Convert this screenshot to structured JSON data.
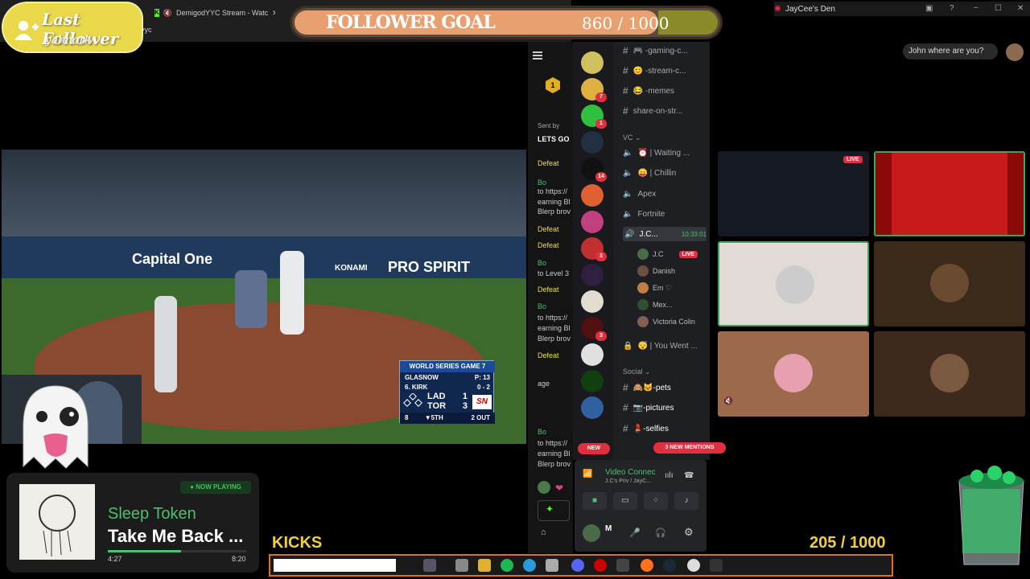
{
  "browser": {
    "tab1": "DemigodYYC Stream - Watc",
    "url": "dyyc"
  },
  "follower": {
    "title": "Last Follower",
    "name": "yalmark"
  },
  "goal": {
    "title": "FOLLOWER GOAL",
    "count": "860  /  1000",
    "current": 860,
    "target": 1000
  },
  "video": {
    "ads": [
      "Capital One",
      "KONAMI",
      "PRO SPIRIT"
    ],
    "scorebug": {
      "header": "WORLD SERIES GAME 7",
      "pitcher": "GLASNOW",
      "pitch_count": "P: 13",
      "batter": "6. KIRK",
      "count": "0 - 2",
      "team1": "LAD",
      "score1": "1",
      "team2": "TOR",
      "score2": "3",
      "number": "8",
      "inning": "▼5TH",
      "outs": "2 OUT",
      "network": "SN"
    }
  },
  "now_playing": {
    "badge": "● NOW PLAYING",
    "artist": "Sleep Token",
    "song": "Take Me Back ...",
    "elapsed": "4:27",
    "duration": "8:20",
    "progress": 0.53
  },
  "overlay": {
    "kicks_label": "KICKS",
    "kicks_count": "205  / 1000"
  },
  "chat": {
    "top_badge": "1",
    "pinned_label": "Sent by",
    "pinned_text": "LETS GO",
    "lines": [
      {
        "text": "Defeat",
        "color": "#e8e040"
      },
      {
        "text": "Bo",
        "color": "#4ec070"
      },
      {
        "text": "to https://",
        "color": "#ccc"
      },
      {
        "text": "earning Bl",
        "color": "#ccc"
      },
      {
        "text": "Blerp brov",
        "color": "#ccc"
      },
      {
        "text": "Defeat",
        "color": "#e8e040"
      },
      {
        "text": "Defeat",
        "color": "#e8e040"
      },
      {
        "text": "Bo",
        "color": "#4ec070"
      },
      {
        "text": "to Level 3",
        "color": "#ccc"
      },
      {
        "text": "Defeat",
        "color": "#e8e040"
      },
      {
        "text": "Bo",
        "color": "#4ec070"
      },
      {
        "text": "to https://",
        "color": "#ccc"
      },
      {
        "text": "earning Bl",
        "color": "#ccc"
      },
      {
        "text": "Blerp brov",
        "color": "#ccc"
      },
      {
        "text": "Defeat",
        "color": "#e8e040"
      },
      {
        "text": "",
        "color": "#ccc"
      },
      {
        "text": "age",
        "color": "#ccc"
      },
      {
        "text": "",
        "color": "#ccc"
      },
      {
        "text": "",
        "color": "#ccc"
      },
      {
        "text": "Bo",
        "color": "#4ec070"
      },
      {
        "text": "to https://",
        "color": "#ccc"
      },
      {
        "text": "earning Bl",
        "color": "#ccc"
      },
      {
        "text": "Blerp brov",
        "color": "#ccc"
      }
    ]
  },
  "servers": {
    "new_label": "NEW",
    "icons": [
      {
        "color": "#d0c060",
        "badge": ""
      },
      {
        "color": "#e0b040",
        "badge": "7"
      },
      {
        "color": "#30c040",
        "badge": "1"
      },
      {
        "color": "#203040",
        "badge": ""
      },
      {
        "color": "#111111",
        "badge": "14"
      },
      {
        "color": "#e06030",
        "badge": ""
      },
      {
        "color": "#c04080",
        "badge": ""
      },
      {
        "color": "#c03030",
        "badge": "3"
      },
      {
        "color": "#302040",
        "badge": ""
      },
      {
        "color": "#e0dcd0",
        "badge": ""
      },
      {
        "color": "#501010",
        "badge": "3"
      },
      {
        "color": "#e0e0e0",
        "badge": ""
      },
      {
        "color": "#104010",
        "badge": ""
      },
      {
        "color": "#3060a0",
        "badge": ""
      }
    ]
  },
  "channels": {
    "text1": [
      "🎮 -gaming-c...",
      "😊 -stream-c...",
      "😂 -memes",
      "share-on-str..."
    ],
    "vc_label": "VC ⌄",
    "voice": [
      "⏰ | Waiting ...",
      "😛 | Chillin",
      "Apex",
      "Fortnite"
    ],
    "active_vc": "J.C...",
    "active_vc_time": "10:33:01",
    "vc_users": [
      {
        "name": "J.C",
        "live": "LIVE",
        "color": "#4a6a4a"
      },
      {
        "name": "Danish",
        "live": "",
        "color": "#6a5040"
      },
      {
        "name": "Em ♡",
        "live": "",
        "color": "#c08040"
      },
      {
        "name": "Mex...",
        "live": "",
        "color": "#305030"
      },
      {
        "name": "Victoria Colin",
        "live": "",
        "color": "#806050"
      }
    ],
    "locked": "😴 | You Went ...",
    "social_label": "Social ⌄",
    "social": [
      "🙈🐱-pets",
      "📷-pictures",
      "💄-selfies"
    ],
    "mentions": "3 NEW MENTIONS"
  },
  "voice_panel": {
    "status": "Video Connec",
    "channel": "J.C's Priv / JayC...",
    "user": "M"
  },
  "right": {
    "window_title": "JayCee's Den",
    "bubble": "John where are you?",
    "live_label": "LIVE"
  },
  "colors": {
    "accent_gold": "#f0d040",
    "discord_red": "#e03040",
    "spotify_green": "#4ec070",
    "taskbar_border": "#e07020"
  }
}
